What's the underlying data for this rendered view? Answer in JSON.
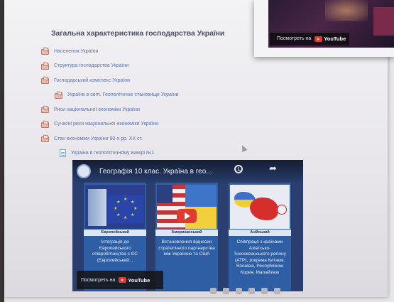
{
  "page": {
    "heading": "Загальна характеристика господарства України"
  },
  "nav": {
    "items": [
      {
        "label": "Населення України",
        "type": "folder",
        "level": 0
      },
      {
        "label": "Структура господарства України",
        "type": "folder",
        "level": 0
      },
      {
        "label": "Господарський комплекс України",
        "type": "folder",
        "level": 0
      },
      {
        "label": "Україна в світі. Геополітичне становище України",
        "type": "folder",
        "level": 1
      },
      {
        "label": "Риси національної економіки України",
        "type": "folder",
        "level": 0
      },
      {
        "label": "Сучасні риси національної економіки України",
        "type": "folder",
        "level": 0
      },
      {
        "label": "Стан економіки України 90-х рр. ХХ ст.",
        "type": "folder",
        "level": 0
      },
      {
        "label": "Україна в геополітичному вимірі №1",
        "type": "document",
        "level": 1
      }
    ]
  },
  "video": {
    "title": "Географія 10 клас. Україна в гео...",
    "watch_label": "Посмотреть на",
    "youtube_label": "YouTube",
    "panels": [
      {
        "label": "Європейський",
        "text": "Інтеграція до Європейського співробітництва з ЄС (Європейський..."
      },
      {
        "label": "Американський",
        "text": "Встановлення відносин стратегічного партнерства між Україною та США"
      },
      {
        "label": "Азійський",
        "text": "Співпраця з країнами Азіатсько-Тихоокеанського регіону (АТР), зокрема Китаєм, Японією, Республікою Корея, Малайзією"
      }
    ]
  },
  "overlay": {
    "watch_label": "Посмотреть на",
    "youtube_label": "YouTube"
  },
  "colors": {
    "link": "#5b72b5",
    "heading": "#4a4f6a",
    "video_bg": "#2a3f70",
    "panel": "#2e5fa4",
    "youtube_red": "#e23a2f"
  }
}
